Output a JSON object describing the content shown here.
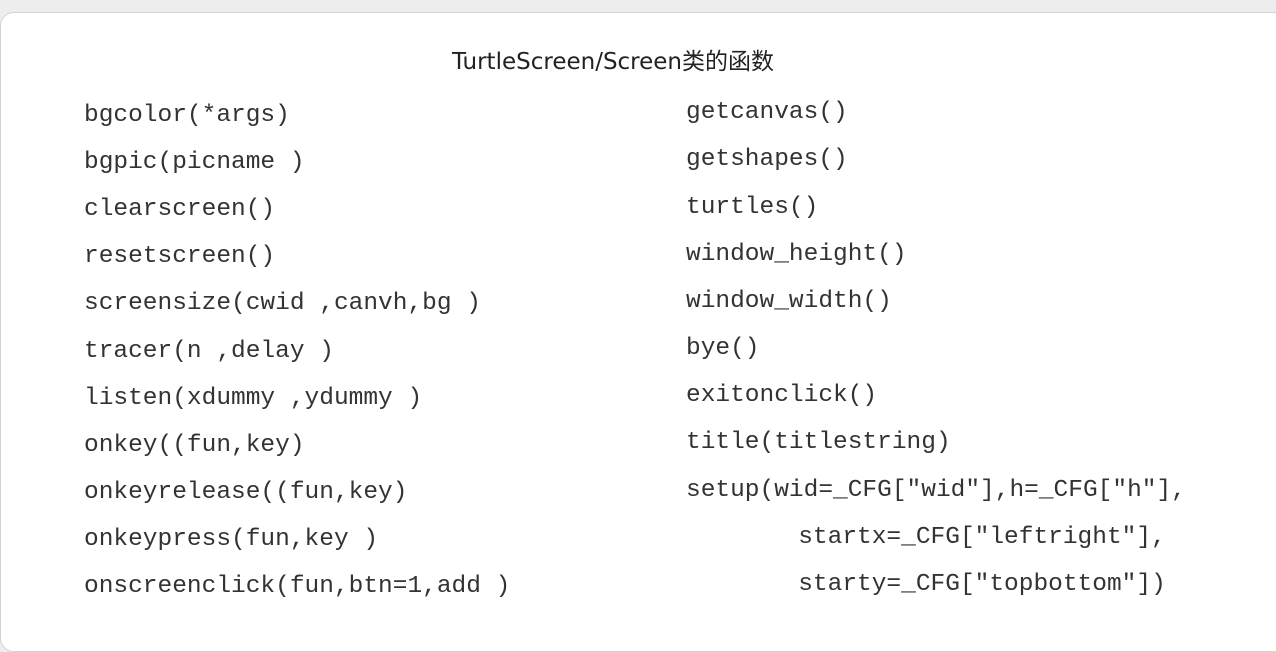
{
  "title": "TurtleScreen/Screen类的函数",
  "left_functions": [
    "bgcolor(*args)",
    "bgpic(picname )",
    "clearscreen()",
    "resetscreen()",
    "screensize(cwid ,canvh,bg )",
    "tracer(n ,delay )",
    "listen(xdummy ,ydummy )",
    "onkey((fun,key)",
    "onkeyrelease((fun,key)",
    "onkeypress(fun,key )",
    "onscreenclick(fun,btn=1,add )"
  ],
  "right_functions": [
    "getcanvas()",
    "getshapes()",
    "turtles()",
    "window_height()",
    "window_width()",
    "bye()",
    "exitonclick()",
    "title(titlestring)",
    "setup(wid=_CFG[\"wid\"],h=_CFG[\"h\"],",
    "      startx=_CFG[\"leftright\"],",
    "      starty=_CFG[\"topbottom\"])"
  ]
}
